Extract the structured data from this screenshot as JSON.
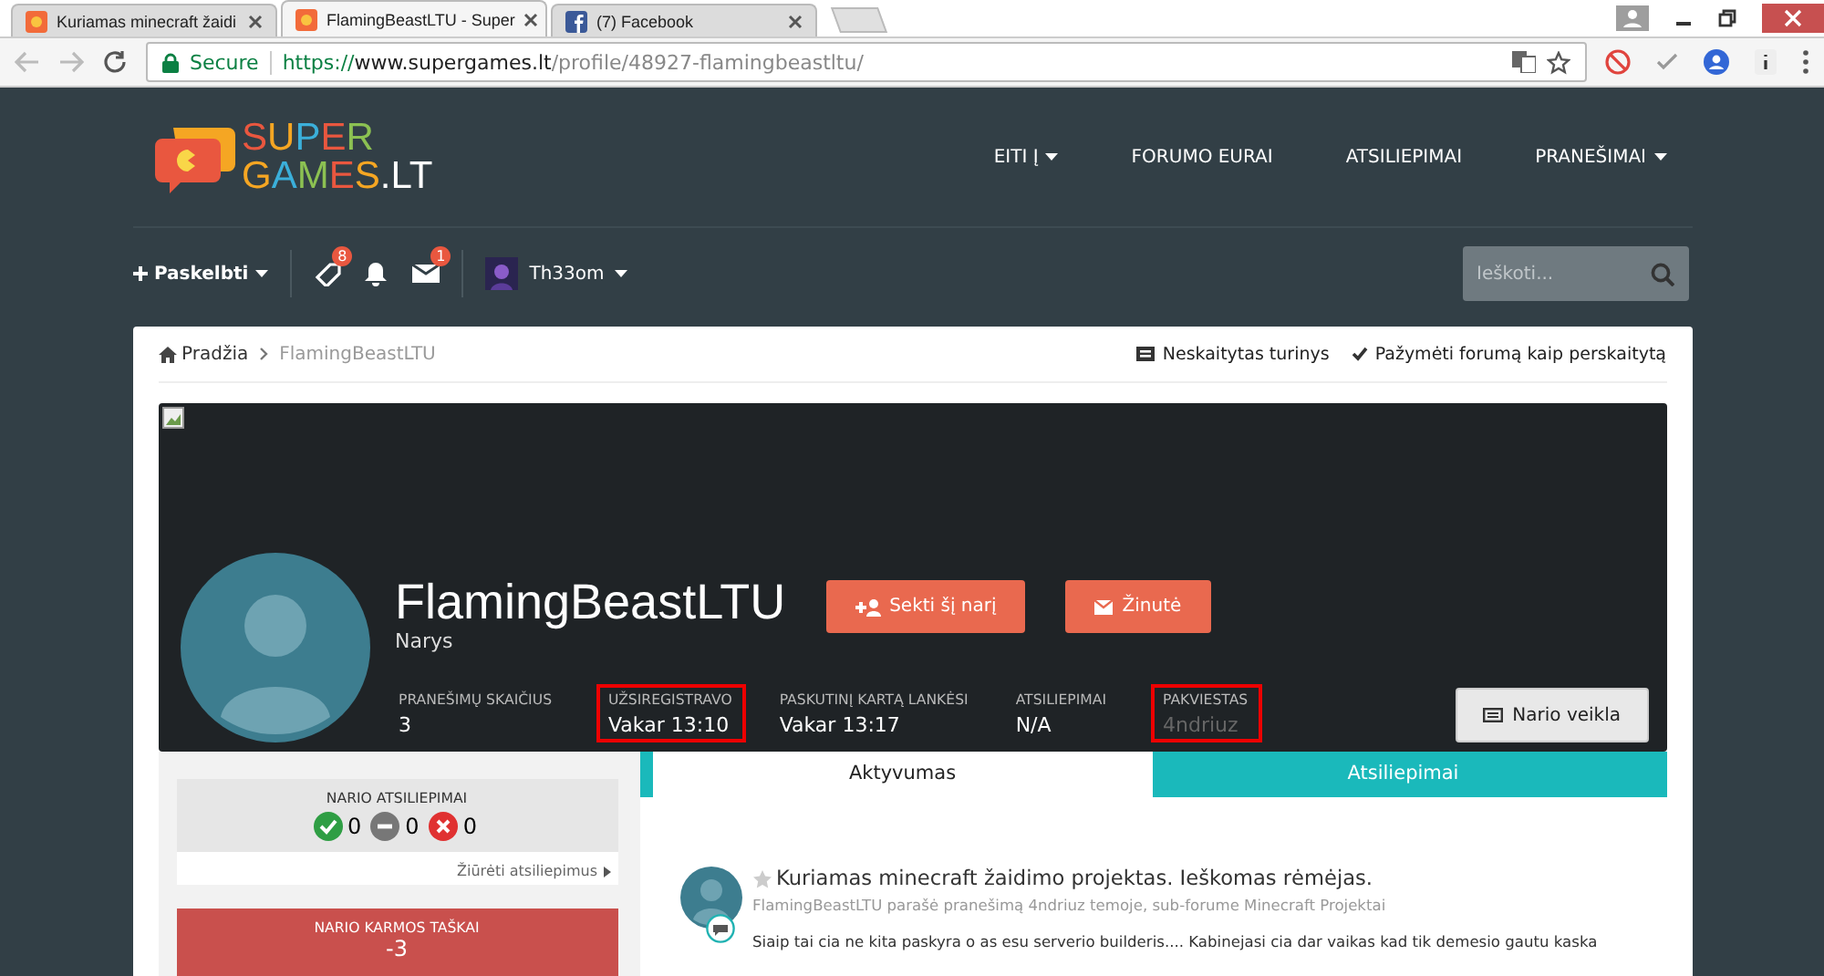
{
  "browser": {
    "tabs": [
      {
        "label": "Kuriamas minecraft žaidi",
        "selected": false,
        "kind": "site"
      },
      {
        "label": "FlamingBeastLTU - Super",
        "selected": true,
        "kind": "site"
      },
      {
        "label": "(7) Facebook",
        "selected": false,
        "kind": "facebook"
      }
    ],
    "secure": "Secure",
    "url_scheme": "https://",
    "url_host": "www.supergames.lt",
    "url_path": "/profile/48927-flamingbeastltu/"
  },
  "header": {
    "logo_top": "SUPER",
    "logo_bottom": "GAMES.LT",
    "nav": [
      {
        "label": "EITI Į",
        "dropdown": true
      },
      {
        "label": "FORUMO EURAI",
        "dropdown": false
      },
      {
        "label": "ATSILIEPIMAI",
        "dropdown": false
      },
      {
        "label": "PRANEŠIMAI",
        "dropdown": true
      }
    ]
  },
  "userbar": {
    "create": "Paskelbti",
    "badges": [
      {
        "kind": "tag",
        "count": "8"
      },
      {
        "kind": "bell"
      },
      {
        "kind": "mail",
        "count": "1"
      }
    ],
    "user": "Th33om",
    "search": {
      "placeholder": "Ieškoti..."
    }
  },
  "breadcrumb": [
    {
      "label": "Pradžia",
      "kind": "home"
    },
    {
      "label": "FlamingBeastLTU",
      "kind": "current"
    }
  ],
  "actions": [
    {
      "label": "Neskaitytas turinys",
      "kind": "unread"
    },
    {
      "label": "Pažymėti forumą kaip perskaitytą",
      "kind": "check"
    }
  ],
  "profile": {
    "name": "FlamingBeastLTU",
    "group": "Narys",
    "buttons": [
      {
        "label": "Sekti šį narį",
        "kind": "follow"
      },
      {
        "label": "Žinutė",
        "kind": "message"
      }
    ],
    "stats": [
      {
        "label": "PRANEŠIMŲ SKAIČIUS",
        "value": "3",
        "highlighted": false,
        "muted": false
      },
      {
        "label": "UŽSIREGISTRAVO",
        "value": "Vakar 13:10",
        "highlighted": true,
        "muted": false
      },
      {
        "label": "PASKUTINĮ KARTĄ LANKĖSI",
        "value": "Vakar 13:17",
        "highlighted": false,
        "muted": false
      },
      {
        "label": "ATSILIEPIMAI",
        "value": "N/A",
        "highlighted": false,
        "muted": false
      },
      {
        "label": "PAKVIESTAS",
        "value": "4ndriuz",
        "highlighted": true,
        "muted": true
      }
    ],
    "activity_button": "Nario veikla"
  },
  "feedback": {
    "title": "NARIO ATSILIEPIMAI",
    "counts": [
      {
        "kind": "positive",
        "value": "0"
      },
      {
        "kind": "neutral",
        "value": "0"
      },
      {
        "kind": "negative",
        "value": "0"
      }
    ],
    "link": "Žiūrėti atsiliepimus"
  },
  "karma": {
    "title": "NARIO KARMOS TAŠKAI",
    "value": "-3"
  },
  "content_tabs": [
    {
      "label": "Aktyvumas",
      "selected": true
    },
    {
      "label": "Atsiliepimai",
      "selected": false
    }
  ],
  "post": {
    "title": "Kuriamas minecraft žaidimo projektas. Ieškomas rėmėjas.",
    "meta": "FlamingBeastLTU parašė pranešimą 4ndriuz temoje, sub-forume Minecraft Projektai",
    "excerpt": "Siaip tai cia ne kita paskyra o as esu serverio builderis.... Kabinejasi cia dar vaikas kad tik demesio gautu kaska"
  }
}
